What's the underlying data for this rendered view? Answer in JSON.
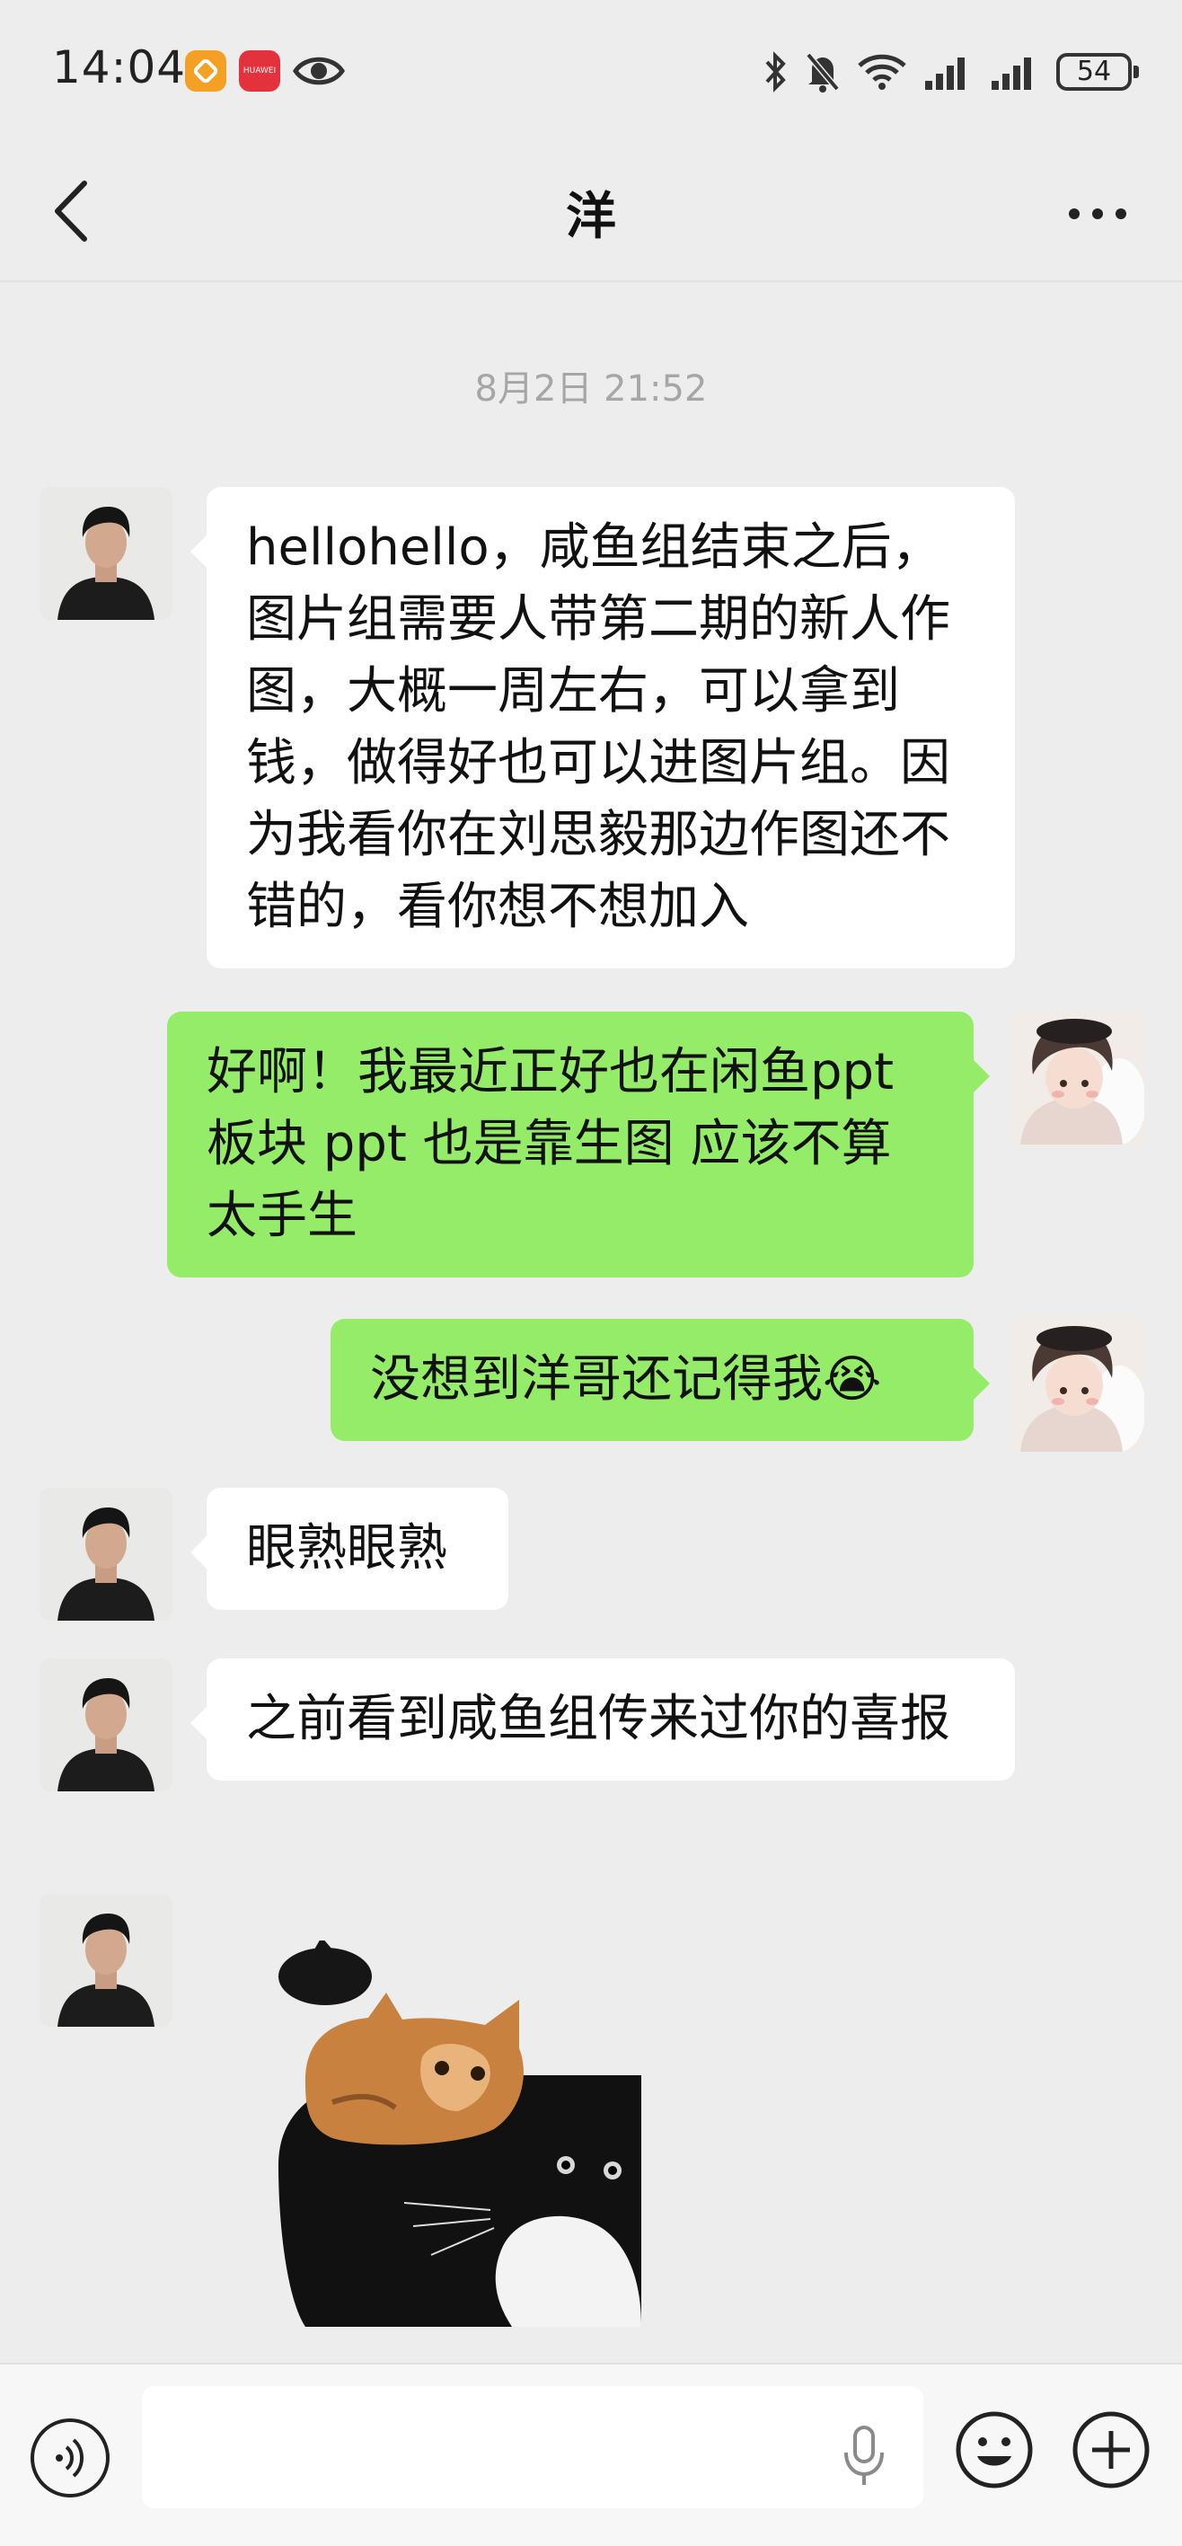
{
  "status_bar": {
    "time": "14:04",
    "battery_level": "54",
    "app_badge_huawei": "HUAWEI"
  },
  "header": {
    "title": "洋"
  },
  "chat": {
    "timestamp": "8月2日 21:52",
    "messages": [
      {
        "sender": "contact",
        "type": "text",
        "text": "hellohello，咸鱼组结束之后，图片组需要人带第二期的新人作图，大概一周左右，可以拿到钱，做得好也可以进图片组。因为我看你在刘思毅那边作图还不错的，看你想不想加入"
      },
      {
        "sender": "me",
        "type": "text",
        "text": "好啊！我最近正好也在闲鱼ppt 板块  ppt 也是靠生图 应该不算太手生"
      },
      {
        "sender": "me",
        "type": "text",
        "text": "没想到洋哥还记得我😭"
      },
      {
        "sender": "contact",
        "type": "text",
        "text": "眼熟眼熟"
      },
      {
        "sender": "contact",
        "type": "text",
        "text": "之前看到咸鱼组传来过你的喜报"
      },
      {
        "sender": "contact",
        "type": "sticker",
        "text": ""
      }
    ]
  },
  "input_bar": {
    "placeholder": ""
  },
  "colors": {
    "background": "#ededed",
    "incoming_bubble": "#ffffff",
    "outgoing_bubble": "#95ec69",
    "timestamp": "#a6a6a6"
  },
  "icons": [
    "back-arrow-icon",
    "more-dots-icon",
    "voice-icon",
    "mic-icon",
    "emoji-icon",
    "plus-icon",
    "bluetooth-icon",
    "mute-icon",
    "wifi-icon",
    "signal-icon",
    "battery-icon",
    "eye-icon"
  ]
}
